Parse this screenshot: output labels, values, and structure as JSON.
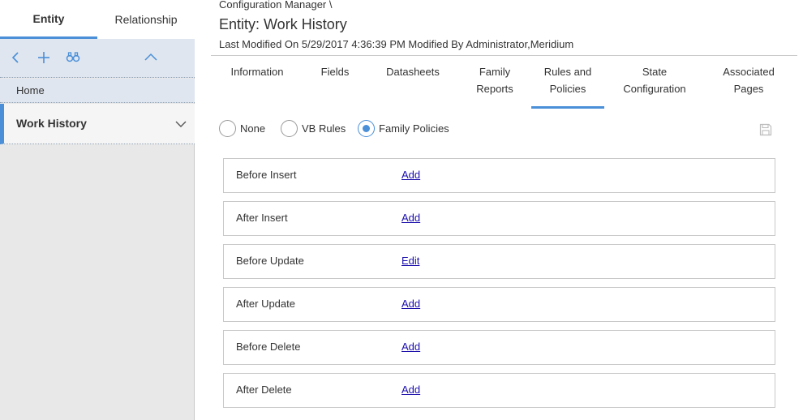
{
  "left": {
    "tabs": [
      "Entity",
      "Relationship"
    ],
    "toolbar_icons": [
      "back-icon",
      "add-icon",
      "search-binoculars-icon",
      "collapse-up-icon"
    ],
    "home": "Home",
    "selected_item": "Work History"
  },
  "header": {
    "breadcrumb": "Configuration Manager \\",
    "title": "Entity: Work History",
    "modified": "Last Modified On 5/29/2017 4:36:39 PM Modified By Administrator,Meridium"
  },
  "tabs": {
    "information": "Information",
    "fields": "Fields",
    "datasheets": "Datasheets",
    "family_reports_1": "Family",
    "family_reports_2": "Reports",
    "rules_1": "Rules and",
    "rules_2": "Policies",
    "state_1": "State",
    "state_2": "Configuration",
    "assoc_1": "Associated",
    "assoc_2": "Pages",
    "active": "Rules and Policies"
  },
  "radios": {
    "none": "None",
    "vb_rules": "VB Rules",
    "family_policies": "Family Policies",
    "selected": "Family Policies"
  },
  "policies": [
    {
      "name": "Before Insert",
      "action": "Add"
    },
    {
      "name": "After Insert",
      "action": "Add"
    },
    {
      "name": "Before Update",
      "action": "Edit"
    },
    {
      "name": "After Update",
      "action": "Add"
    },
    {
      "name": "Before Delete",
      "action": "Add"
    },
    {
      "name": "After Delete",
      "action": "Add"
    }
  ],
  "colors": {
    "accent": "#4a8fd8",
    "link": "#1a0dab",
    "panel": "#dfe6ef"
  }
}
